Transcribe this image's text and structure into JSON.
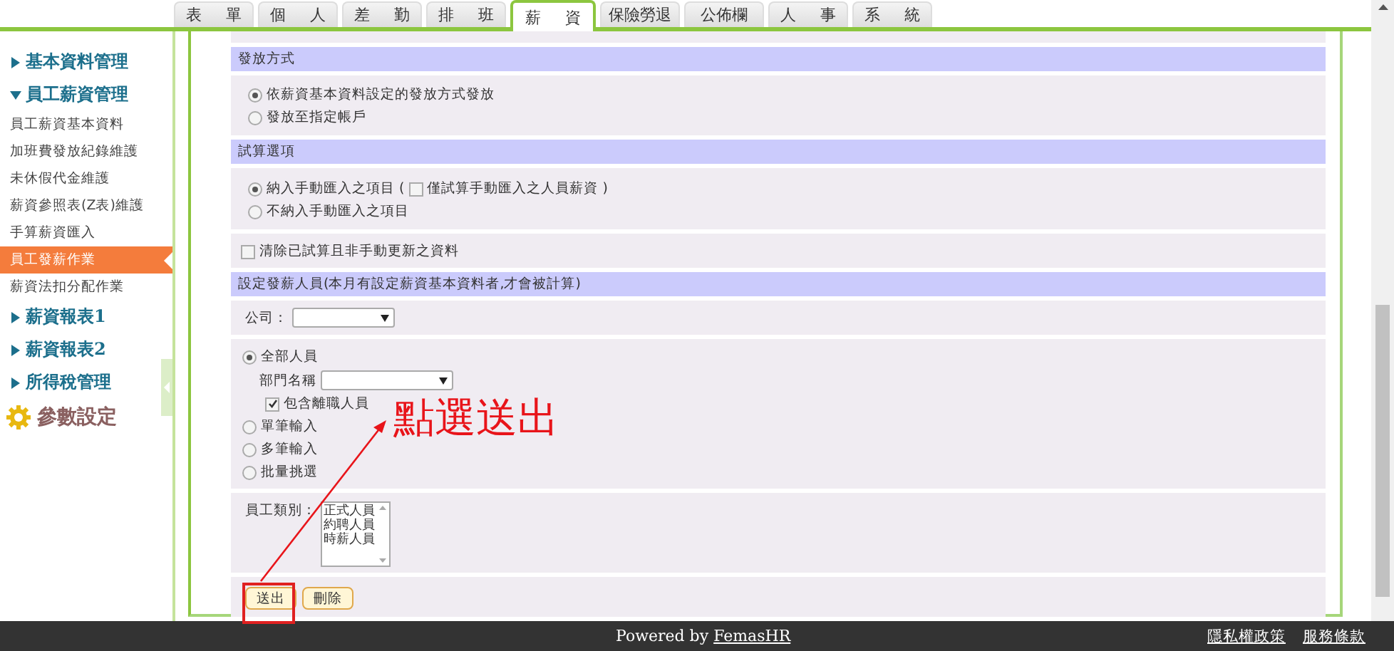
{
  "tabs": [
    {
      "label": "表 單",
      "selected": false
    },
    {
      "label": "個 人",
      "selected": false
    },
    {
      "label": "差 勤",
      "selected": false
    },
    {
      "label": "排 班",
      "selected": false
    },
    {
      "label": "薪 資",
      "selected": true
    },
    {
      "label": "保險勞退",
      "selected": false
    },
    {
      "label": "公佈欄",
      "selected": false
    },
    {
      "label": "人 事",
      "selected": false
    },
    {
      "label": "系 統",
      "selected": false
    }
  ],
  "sidebar": {
    "items": [
      {
        "kind": "group",
        "label": "基本資料管理",
        "expanded": false
      },
      {
        "kind": "group",
        "label": "員工薪資管理",
        "expanded": true,
        "children": [
          {
            "label": "員工薪資基本資料",
            "selected": false
          },
          {
            "label": "加班費發放紀錄維護",
            "selected": false
          },
          {
            "label": "未休假代金維護",
            "selected": false
          },
          {
            "label": "薪資參照表(Z表)維護",
            "selected": false
          },
          {
            "label": "手算薪資匯入",
            "selected": false
          },
          {
            "label": "員工發薪作業",
            "selected": true
          },
          {
            "label": "薪資法扣分配作業",
            "selected": false
          }
        ]
      },
      {
        "kind": "group",
        "label": "薪資報表1",
        "expanded": false
      },
      {
        "kind": "group",
        "label": "薪資報表2",
        "expanded": false
      },
      {
        "kind": "group",
        "label": "所得稅管理",
        "expanded": false
      },
      {
        "kind": "settings",
        "label": "參數設定"
      }
    ]
  },
  "payment": {
    "title": "發放方式",
    "options": [
      {
        "label": "依薪資基本資料設定的發放方式發放",
        "selected": true
      },
      {
        "label": "發放至指定帳戶",
        "selected": false
      }
    ]
  },
  "calc": {
    "title": "試算選項",
    "options": [
      {
        "label": "納入手動匯入之項目 (",
        "selected": true,
        "sub_checkbox": {
          "label": "僅試算手動匯入之人員薪資",
          "checked": false
        },
        "suffix": ")"
      },
      {
        "label": "不納入手動匯入之項目",
        "selected": false
      }
    ],
    "clear_checkbox": {
      "label": "清除已試算且非手動更新之資料",
      "checked": false
    }
  },
  "staff": {
    "title": "設定發薪人員(本月有設定薪資基本資料者,才會被計算)",
    "company_label": "公司：",
    "scope": [
      {
        "label": "全部人員",
        "selected": true
      },
      {
        "label": "單筆輸入",
        "selected": false
      },
      {
        "label": "多筆輸入",
        "selected": false
      },
      {
        "label": "批量挑選",
        "selected": false
      }
    ],
    "department_label": "部門名稱",
    "include_resigned": {
      "label": "包含離職人員",
      "checked": true
    },
    "category_label": "員工類別：",
    "categories": [
      "正式人員",
      "約聘人員",
      "時薪人員"
    ]
  },
  "buttons": [
    {
      "label": "送出",
      "highlighted": true
    },
    {
      "label": "刪除",
      "highlighted": false
    }
  ],
  "annotation": {
    "text": "點選送出"
  },
  "footer": {
    "powered_by": "Powered by ",
    "brand": "FemasHR",
    "links": [
      "隱私權政策",
      "服務條款"
    ]
  }
}
